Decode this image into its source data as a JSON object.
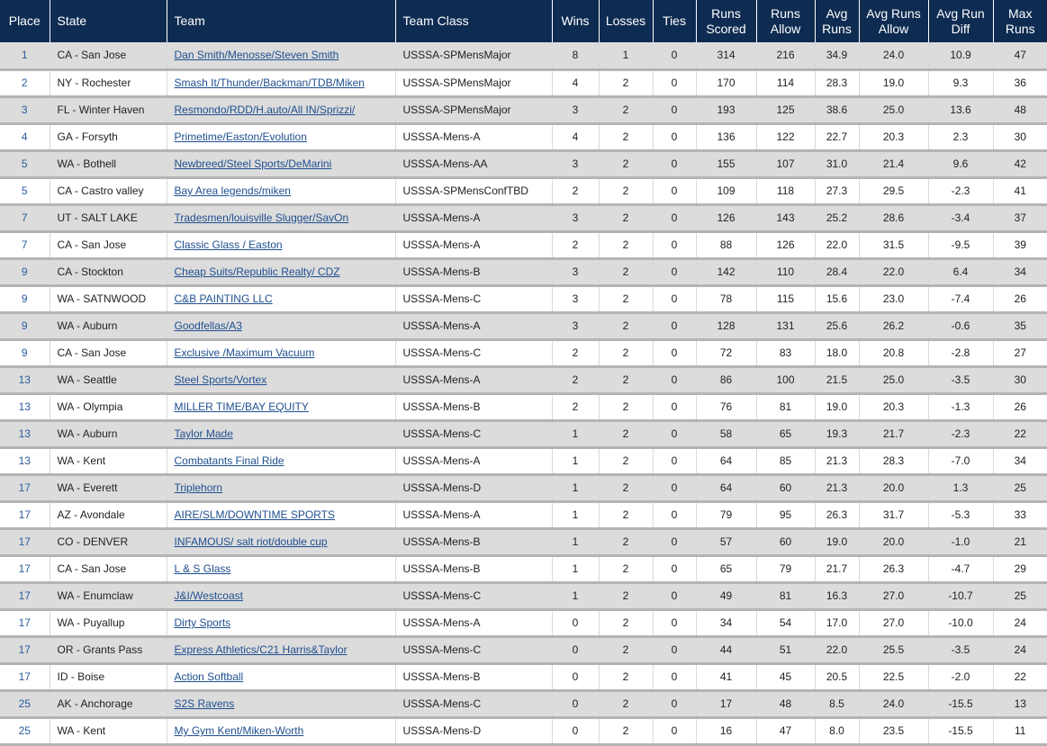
{
  "headers": {
    "place": "Place",
    "state": "State",
    "team": "Team",
    "team_class": "Team Class",
    "wins": "Wins",
    "losses": "Losses",
    "ties": "Ties",
    "runs_scored": "Runs Scored",
    "runs_allow": "Runs Allow",
    "avg_runs": "Avg Runs",
    "avg_runs_allow": "Avg Runs Allow",
    "avg_run_diff": "Avg Run Diff",
    "max_runs": "Max Runs"
  },
  "colors": {
    "header_bg": "#0e2c52",
    "row_alt_bg": "#dcdcdc",
    "link": "#1f4f8f"
  },
  "rows": [
    {
      "place": "1",
      "state": "CA - San Jose",
      "team": "Dan Smith/Menosse/Steven Smith",
      "team_class": "USSSA-SPMensMajor",
      "wins": "8",
      "losses": "1",
      "ties": "0",
      "runs_scored": "314",
      "runs_allow": "216",
      "avg_runs": "34.9",
      "avg_runs_allow": "24.0",
      "avg_run_diff": "10.9",
      "max_runs": "47"
    },
    {
      "place": "2",
      "state": "NY - Rochester",
      "team": "Smash It/Thunder/Backman/TDB/Miken",
      "team_class": "USSSA-SPMensMajor",
      "wins": "4",
      "losses": "2",
      "ties": "0",
      "runs_scored": "170",
      "runs_allow": "114",
      "avg_runs": "28.3",
      "avg_runs_allow": "19.0",
      "avg_run_diff": "9.3",
      "max_runs": "36"
    },
    {
      "place": "3",
      "state": "FL - Winter Haven",
      "team": "Resmondo/RDD/H.auto/All IN/Sprizzi/",
      "team_class": "USSSA-SPMensMajor",
      "wins": "3",
      "losses": "2",
      "ties": "0",
      "runs_scored": "193",
      "runs_allow": "125",
      "avg_runs": "38.6",
      "avg_runs_allow": "25.0",
      "avg_run_diff": "13.6",
      "max_runs": "48"
    },
    {
      "place": "4",
      "state": "GA - Forsyth",
      "team": "Primetime/Easton/Evolution",
      "team_class": "USSSA-Mens-A",
      "wins": "4",
      "losses": "2",
      "ties": "0",
      "runs_scored": "136",
      "runs_allow": "122",
      "avg_runs": "22.7",
      "avg_runs_allow": "20.3",
      "avg_run_diff": "2.3",
      "max_runs": "30"
    },
    {
      "place": "5",
      "state": "WA - Bothell",
      "team": "Newbreed/Steel Sports/DeMarini",
      "team_class": "USSSA-Mens-AA",
      "wins": "3",
      "losses": "2",
      "ties": "0",
      "runs_scored": "155",
      "runs_allow": "107",
      "avg_runs": "31.0",
      "avg_runs_allow": "21.4",
      "avg_run_diff": "9.6",
      "max_runs": "42"
    },
    {
      "place": "5",
      "state": "CA - Castro valley",
      "team": "Bay Area legends/miken",
      "team_class": "USSSA-SPMensConfTBD",
      "wins": "2",
      "losses": "2",
      "ties": "0",
      "runs_scored": "109",
      "runs_allow": "118",
      "avg_runs": "27.3",
      "avg_runs_allow": "29.5",
      "avg_run_diff": "-2.3",
      "max_runs": "41"
    },
    {
      "place": "7",
      "state": "UT - SALT LAKE",
      "team": "Tradesmen/louisville Slugger/SavOn",
      "team_class": "USSSA-Mens-A",
      "wins": "3",
      "losses": "2",
      "ties": "0",
      "runs_scored": "126",
      "runs_allow": "143",
      "avg_runs": "25.2",
      "avg_runs_allow": "28.6",
      "avg_run_diff": "-3.4",
      "max_runs": "37"
    },
    {
      "place": "7",
      "state": "CA - San Jose",
      "team": "Classic Glass / Easton",
      "team_class": "USSSA-Mens-A",
      "wins": "2",
      "losses": "2",
      "ties": "0",
      "runs_scored": "88",
      "runs_allow": "126",
      "avg_runs": "22.0",
      "avg_runs_allow": "31.5",
      "avg_run_diff": "-9.5",
      "max_runs": "39"
    },
    {
      "place": "9",
      "state": "CA - Stockton",
      "team": "Cheap Suits/Republic Realty/ CDZ",
      "team_class": "USSSA-Mens-B",
      "wins": "3",
      "losses": "2",
      "ties": "0",
      "runs_scored": "142",
      "runs_allow": "110",
      "avg_runs": "28.4",
      "avg_runs_allow": "22.0",
      "avg_run_diff": "6.4",
      "max_runs": "34"
    },
    {
      "place": "9",
      "state": "WA - SATNWOOD",
      "team": "C&B PAINTING LLC",
      "team_class": "USSSA-Mens-C",
      "wins": "3",
      "losses": "2",
      "ties": "0",
      "runs_scored": "78",
      "runs_allow": "115",
      "avg_runs": "15.6",
      "avg_runs_allow": "23.0",
      "avg_run_diff": "-7.4",
      "max_runs": "26"
    },
    {
      "place": "9",
      "state": "WA - Auburn",
      "team": "Goodfellas/A3",
      "team_class": "USSSA-Mens-A",
      "wins": "3",
      "losses": "2",
      "ties": "0",
      "runs_scored": "128",
      "runs_allow": "131",
      "avg_runs": "25.6",
      "avg_runs_allow": "26.2",
      "avg_run_diff": "-0.6",
      "max_runs": "35"
    },
    {
      "place": "9",
      "state": "CA - San Jose",
      "team": "Exclusive /Maximum Vacuum",
      "team_class": "USSSA-Mens-C",
      "wins": "2",
      "losses": "2",
      "ties": "0",
      "runs_scored": "72",
      "runs_allow": "83",
      "avg_runs": "18.0",
      "avg_runs_allow": "20.8",
      "avg_run_diff": "-2.8",
      "max_runs": "27"
    },
    {
      "place": "13",
      "state": "WA - Seattle",
      "team": "Steel Sports/Vortex",
      "team_class": "USSSA-Mens-A",
      "wins": "2",
      "losses": "2",
      "ties": "0",
      "runs_scored": "86",
      "runs_allow": "100",
      "avg_runs": "21.5",
      "avg_runs_allow": "25.0",
      "avg_run_diff": "-3.5",
      "max_runs": "30"
    },
    {
      "place": "13",
      "state": "WA - Olympia",
      "team": "MILLER TIME/BAY EQUITY",
      "team_class": "USSSA-Mens-B",
      "wins": "2",
      "losses": "2",
      "ties": "0",
      "runs_scored": "76",
      "runs_allow": "81",
      "avg_runs": "19.0",
      "avg_runs_allow": "20.3",
      "avg_run_diff": "-1.3",
      "max_runs": "26"
    },
    {
      "place": "13",
      "state": "WA - Auburn",
      "team": "Taylor Made",
      "team_class": "USSSA-Mens-C",
      "wins": "1",
      "losses": "2",
      "ties": "0",
      "runs_scored": "58",
      "runs_allow": "65",
      "avg_runs": "19.3",
      "avg_runs_allow": "21.7",
      "avg_run_diff": "-2.3",
      "max_runs": "22"
    },
    {
      "place": "13",
      "state": "WA - Kent",
      "team": "Combatants Final Ride",
      "team_class": "USSSA-Mens-A",
      "wins": "1",
      "losses": "2",
      "ties": "0",
      "runs_scored": "64",
      "runs_allow": "85",
      "avg_runs": "21.3",
      "avg_runs_allow": "28.3",
      "avg_run_diff": "-7.0",
      "max_runs": "34"
    },
    {
      "place": "17",
      "state": "WA - Everett",
      "team": "Triplehorn",
      "team_class": "USSSA-Mens-D",
      "wins": "1",
      "losses": "2",
      "ties": "0",
      "runs_scored": "64",
      "runs_allow": "60",
      "avg_runs": "21.3",
      "avg_runs_allow": "20.0",
      "avg_run_diff": "1.3",
      "max_runs": "25"
    },
    {
      "place": "17",
      "state": "AZ - Avondale",
      "team": "AIRE/SLM/DOWNTIME SPORTS",
      "team_class": "USSSA-Mens-A",
      "wins": "1",
      "losses": "2",
      "ties": "0",
      "runs_scored": "79",
      "runs_allow": "95",
      "avg_runs": "26.3",
      "avg_runs_allow": "31.7",
      "avg_run_diff": "-5.3",
      "max_runs": "33"
    },
    {
      "place": "17",
      "state": "CO - DENVER",
      "team": "INFAMOUS/ salt riot/double cup",
      "team_class": "USSSA-Mens-B",
      "wins": "1",
      "losses": "2",
      "ties": "0",
      "runs_scored": "57",
      "runs_allow": "60",
      "avg_runs": "19.0",
      "avg_runs_allow": "20.0",
      "avg_run_diff": "-1.0",
      "max_runs": "21"
    },
    {
      "place": "17",
      "state": "CA - San Jose",
      "team": "L & S Glass",
      "team_class": "USSSA-Mens-B",
      "wins": "1",
      "losses": "2",
      "ties": "0",
      "runs_scored": "65",
      "runs_allow": "79",
      "avg_runs": "21.7",
      "avg_runs_allow": "26.3",
      "avg_run_diff": "-4.7",
      "max_runs": "29"
    },
    {
      "place": "17",
      "state": "WA - Enumclaw",
      "team": "J&I/Westcoast",
      "team_class": "USSSA-Mens-C",
      "wins": "1",
      "losses": "2",
      "ties": "0",
      "runs_scored": "49",
      "runs_allow": "81",
      "avg_runs": "16.3",
      "avg_runs_allow": "27.0",
      "avg_run_diff": "-10.7",
      "max_runs": "25"
    },
    {
      "place": "17",
      "state": "WA - Puyallup",
      "team": "Dirty Sports",
      "team_class": "USSSA-Mens-A",
      "wins": "0",
      "losses": "2",
      "ties": "0",
      "runs_scored": "34",
      "runs_allow": "54",
      "avg_runs": "17.0",
      "avg_runs_allow": "27.0",
      "avg_run_diff": "-10.0",
      "max_runs": "24"
    },
    {
      "place": "17",
      "state": "OR - Grants Pass",
      "team": "Express Athletics/C21 Harris&Taylor",
      "team_class": "USSSA-Mens-C",
      "wins": "0",
      "losses": "2",
      "ties": "0",
      "runs_scored": "44",
      "runs_allow": "51",
      "avg_runs": "22.0",
      "avg_runs_allow": "25.5",
      "avg_run_diff": "-3.5",
      "max_runs": "24"
    },
    {
      "place": "17",
      "state": "ID - Boise",
      "team": "Action Softball",
      "team_class": "USSSA-Mens-B",
      "wins": "0",
      "losses": "2",
      "ties": "0",
      "runs_scored": "41",
      "runs_allow": "45",
      "avg_runs": "20.5",
      "avg_runs_allow": "22.5",
      "avg_run_diff": "-2.0",
      "max_runs": "22"
    },
    {
      "place": "25",
      "state": "AK - Anchorage",
      "team": "S2S Ravens",
      "team_class": "USSSA-Mens-C",
      "wins": "0",
      "losses": "2",
      "ties": "0",
      "runs_scored": "17",
      "runs_allow": "48",
      "avg_runs": "8.5",
      "avg_runs_allow": "24.0",
      "avg_run_diff": "-15.5",
      "max_runs": "13"
    },
    {
      "place": "25",
      "state": "WA - Kent",
      "team": "My Gym Kent/Miken-Worth",
      "team_class": "USSSA-Mens-D",
      "wins": "0",
      "losses": "2",
      "ties": "0",
      "runs_scored": "16",
      "runs_allow": "47",
      "avg_runs": "8.0",
      "avg_runs_allow": "23.5",
      "avg_run_diff": "-15.5",
      "max_runs": "11"
    }
  ]
}
